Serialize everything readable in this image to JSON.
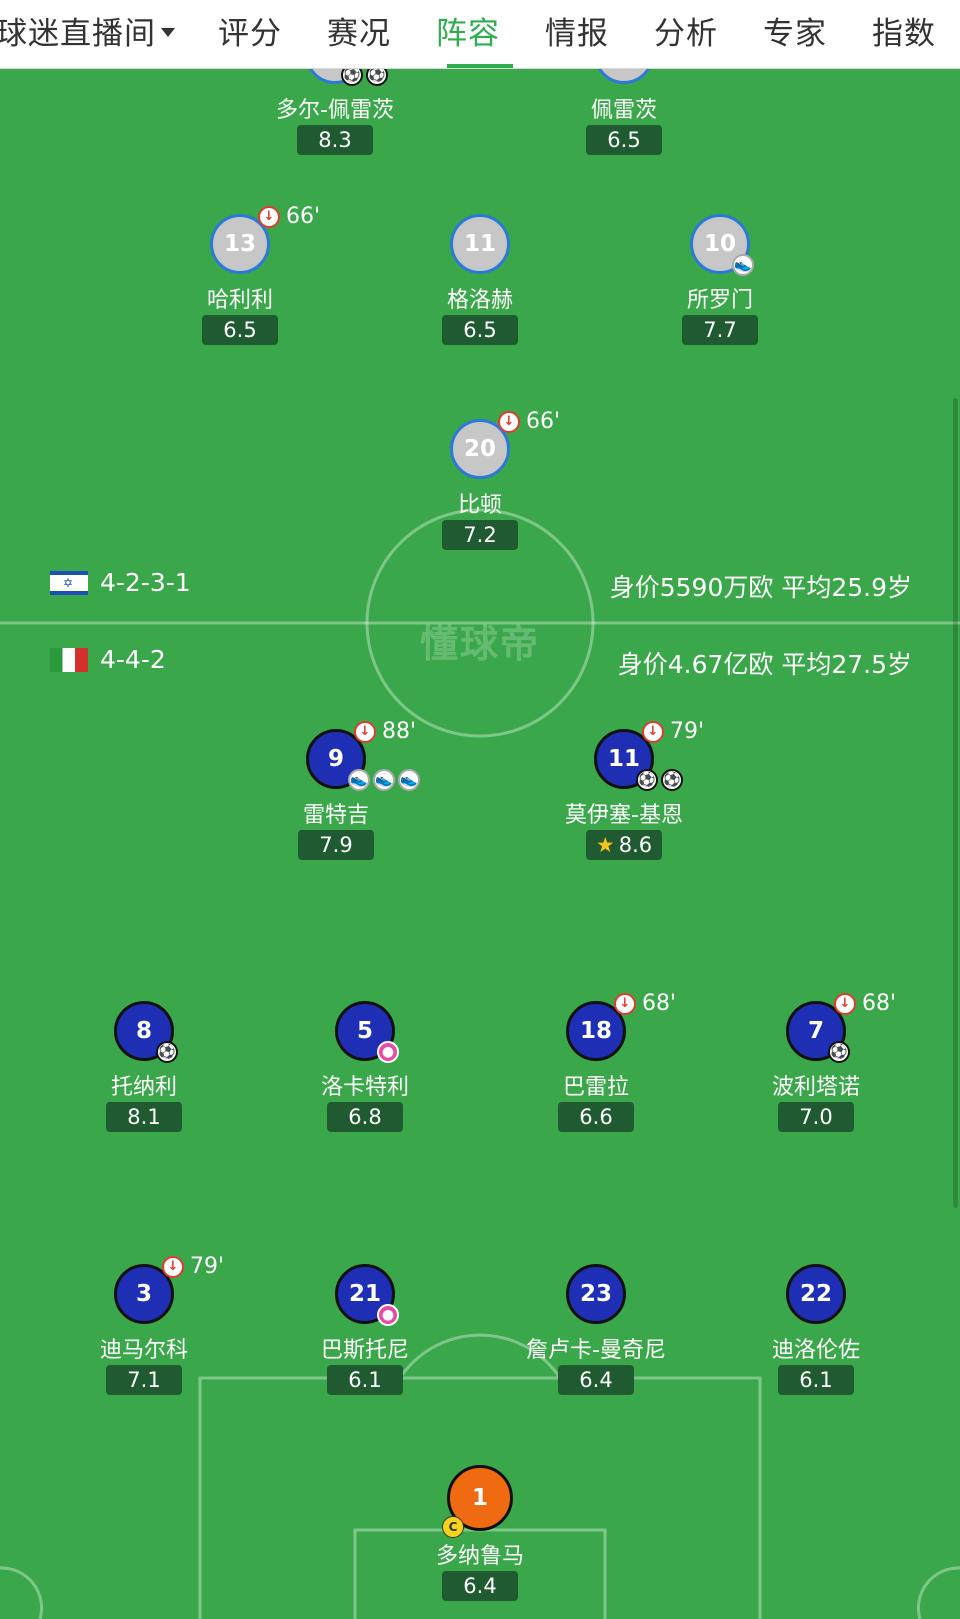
{
  "tabs": [
    {
      "label": "球迷直播间",
      "active": false,
      "dropdown": true
    },
    {
      "label": "评分",
      "active": false
    },
    {
      "label": "赛况",
      "active": false
    },
    {
      "label": "阵容",
      "active": true
    },
    {
      "label": "情报",
      "active": false
    },
    {
      "label": "分析",
      "active": false
    },
    {
      "label": "专家",
      "active": false
    },
    {
      "label": "指数",
      "active": false
    }
  ],
  "colors": {
    "accent": "#2fae4f",
    "pitch": "#3aa84a",
    "away_kit": "#c7c7c7",
    "home_kit": "#1f2fb5",
    "gk_kit": "#f06a12",
    "rating_bg": "#1f5a31"
  },
  "watermark": "懂球帝",
  "away_team": {
    "flag": "israel-flag",
    "formation": "4-2-3-1",
    "value": "身价5590万欧 平均25.9岁"
  },
  "home_team": {
    "flag": "italy-flag",
    "formation": "4-4-2",
    "value": "身价4.67亿欧  平均27.5岁"
  },
  "players": {
    "a_dor": {
      "name": "多尔-佩雷茨",
      "rating": "8.3",
      "events": [
        "goal-icon",
        "goal-icon"
      ]
    },
    "a_peretz": {
      "name": "佩雷茨",
      "rating": "6.5"
    },
    "a13": {
      "number": "13",
      "name": "哈利利",
      "rating": "6.5",
      "sub_min": "66'"
    },
    "a11": {
      "number": "11",
      "name": "格洛赫",
      "rating": "6.5"
    },
    "a10": {
      "number": "10",
      "name": "所罗门",
      "rating": "7.7",
      "events": [
        "assist-boot-icon"
      ]
    },
    "a20": {
      "number": "20",
      "name": "比顿",
      "rating": "7.2",
      "sub_min": "66'"
    },
    "h9": {
      "number": "9",
      "name": "雷特吉",
      "rating": "7.9",
      "sub_min": "88'",
      "events": [
        "assist-boot-icon",
        "assist-boot-icon",
        "assist-boot-icon"
      ]
    },
    "h11": {
      "number": "11",
      "name": "莫伊塞-基恩",
      "rating": "8.6",
      "sub_min": "79'",
      "events": [
        "goal-icon",
        "goal-icon"
      ],
      "mvp": true
    },
    "h8": {
      "number": "8",
      "name": "托纳利",
      "rating": "8.1",
      "events": [
        "goal-icon"
      ]
    },
    "h5": {
      "number": "5",
      "name": "洛卡特利",
      "rating": "6.8",
      "events": [
        "pink-ball-icon"
      ]
    },
    "h18": {
      "number": "18",
      "name": "巴雷拉",
      "rating": "6.6",
      "sub_min": "68'"
    },
    "h7": {
      "number": "7",
      "name": "波利塔诺",
      "rating": "7.0",
      "sub_min": "68'",
      "events": [
        "goal-icon"
      ]
    },
    "h3": {
      "number": "3",
      "name": "迪马尔科",
      "rating": "7.1",
      "sub_min": "79'"
    },
    "h21": {
      "number": "21",
      "name": "巴斯托尼",
      "rating": "6.1",
      "events": [
        "pink-ball-icon"
      ]
    },
    "h23": {
      "number": "23",
      "name": "詹卢卡-曼奇尼",
      "rating": "6.4"
    },
    "h22": {
      "number": "22",
      "name": "迪洛伦佐",
      "rating": "6.1"
    },
    "h1": {
      "number": "1",
      "name": "多纳鲁马",
      "rating": "6.4",
      "captain": "C"
    }
  }
}
